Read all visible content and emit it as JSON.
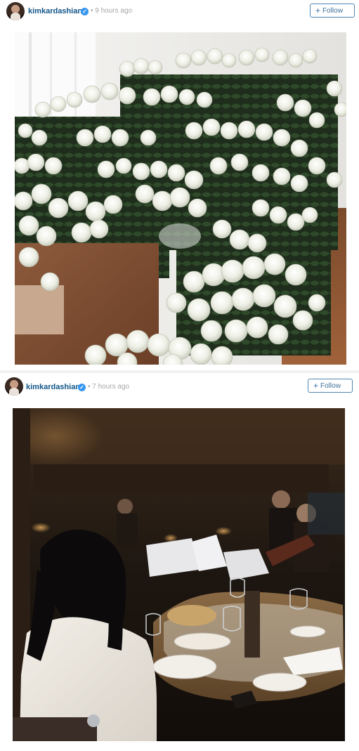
{
  "posts": [
    {
      "username": "kimkardashian",
      "time_ago": "9 hours ago",
      "follow_label": "Follow",
      "follow_icon": "plus-icon",
      "verified_icon": "verified-badge-icon"
    },
    {
      "username": "kimkardashian",
      "time_ago": "7 hours ago",
      "follow_label": "Follow",
      "follow_icon": "plus-icon",
      "verified_icon": "verified-badge-icon"
    }
  ],
  "colors": {
    "username": "#125688",
    "follow_text": "#3f729b",
    "follow_border": "#4e86b3",
    "verified": "#3897f0",
    "timestamp": "#a5a7aa"
  }
}
